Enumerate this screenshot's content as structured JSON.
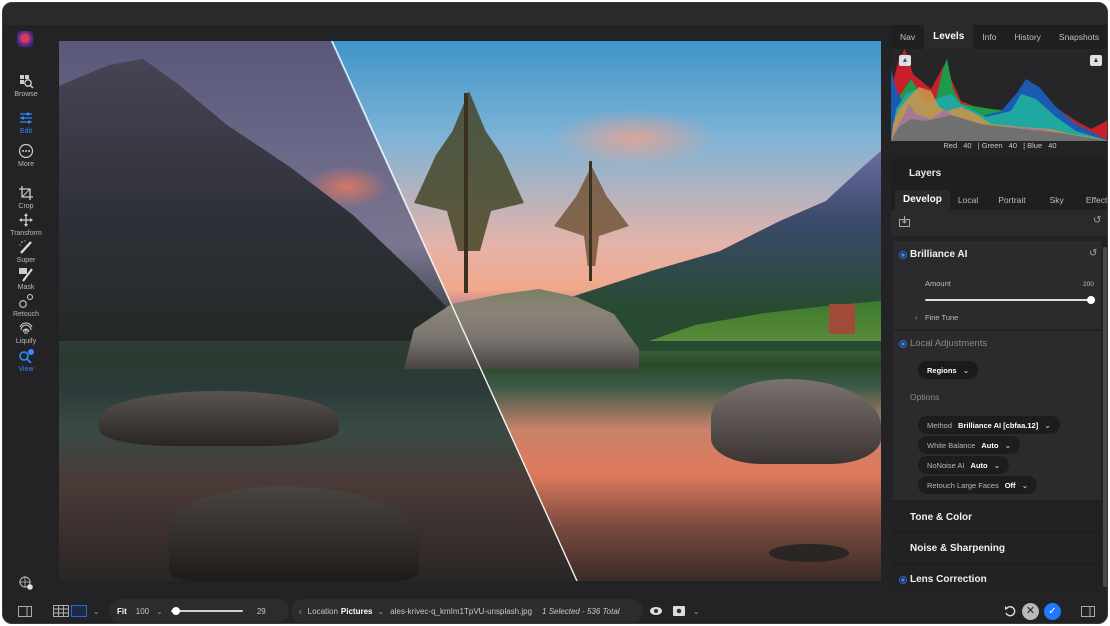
{
  "left_toolbar": {
    "tools": [
      {
        "id": "browse",
        "label": "Browse",
        "icon": "browse-icon"
      },
      {
        "id": "edit",
        "label": "Edit",
        "icon": "sliders-icon",
        "active": true
      },
      {
        "id": "more",
        "label": "More",
        "icon": "more-icon"
      },
      {
        "id": "crop",
        "label": "Crop",
        "icon": "crop-icon"
      },
      {
        "id": "transform",
        "label": "Transform",
        "icon": "move-icon"
      },
      {
        "id": "super",
        "label": "Super",
        "icon": "magic-wand-icon"
      },
      {
        "id": "mask",
        "label": "Mask",
        "icon": "mask-brush-icon"
      },
      {
        "id": "retouch",
        "label": "Retouch",
        "icon": "retouch-icon"
      },
      {
        "id": "liquify",
        "label": "Liquify",
        "icon": "fingerprint-icon"
      },
      {
        "id": "view",
        "label": "View",
        "icon": "view-zoom-icon",
        "active": true
      }
    ],
    "accent_color": "#2d8cff"
  },
  "right_panel": {
    "tabs": [
      "Nav",
      "Levels",
      "Info",
      "History",
      "Snapshots"
    ],
    "active_tab": "Levels",
    "histogram": {
      "label_red": "Red",
      "value_red": "40",
      "label_green": "| Green",
      "value_green": "40",
      "label_blue": "| Blue",
      "value_blue": "40"
    },
    "layers_title": "Layers",
    "develop_tabs": [
      "Develop",
      "Local",
      "Portrait",
      "Sky",
      "Effects"
    ],
    "active_develop_tab": "Develop",
    "brilliance": {
      "title": "Brilliance AI",
      "amount_label": "Amount",
      "amount_value": "200",
      "amount_fraction": 1.0,
      "fine_tune_label": "Fine Tune"
    },
    "local_adjustments": {
      "title": "Local Adjustments",
      "regions_label": "Regions",
      "options_label": "Options",
      "options": [
        {
          "label": "Method",
          "value": "Brilliance AI [cbfaa.12]"
        },
        {
          "label": "White Balance",
          "value": "Auto"
        },
        {
          "label": "NoNoise AI",
          "value": "Auto"
        },
        {
          "label": "Retouch Large Faces",
          "value": "Off"
        }
      ]
    },
    "collapsed_sections": [
      {
        "title": "Tone & Color",
        "active": false
      },
      {
        "title": "Noise & Sharpening",
        "active": false
      },
      {
        "title": "Lens Correction",
        "active": true
      }
    ]
  },
  "bottom_bar": {
    "fit_label": "Fit",
    "zoom_value": "100",
    "thumb_size_value": "29",
    "thumb_size_fraction": 0.02,
    "location_label": "Location",
    "location_value": "Pictures",
    "filename": "ales-krivec-q_kmIm1TpVU-unsplash.jpg",
    "selection_status": "1 Selected - 536 Total"
  }
}
